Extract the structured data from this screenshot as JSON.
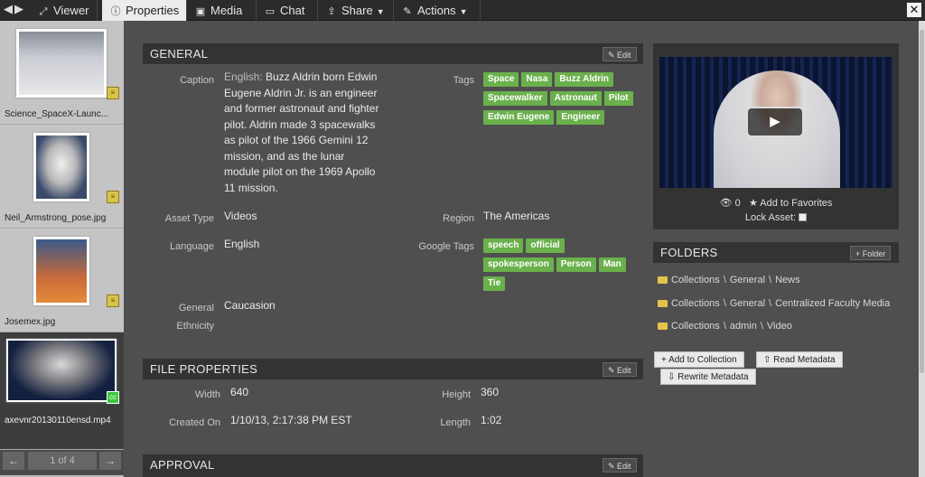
{
  "topbar": {
    "tabs": [
      {
        "label": "Viewer",
        "icon": "expand-icon"
      },
      {
        "label": "Properties",
        "icon": "info-icon"
      },
      {
        "label": "Media",
        "icon": "image-icon"
      },
      {
        "label": "Chat",
        "icon": "comment-icon"
      },
      {
        "label": "Share",
        "icon": "share-icon"
      },
      {
        "label": "Actions",
        "icon": "edit-icon"
      }
    ],
    "close_label": "✕"
  },
  "sidebar": {
    "items": [
      {
        "name": "Science_SpaceX-Launc..."
      },
      {
        "name": "Neil_Armstrong_pose.jpg"
      },
      {
        "name": "Josemex.jpg"
      },
      {
        "name": "axevnr20130110ensd.mp4"
      }
    ],
    "pager": {
      "text": "1 of 4"
    }
  },
  "general": {
    "title": "GENERAL",
    "edit_label": "Edit",
    "caption_label": "Caption",
    "caption_lang": "English:",
    "caption_text": "Buzz Aldrin born Edwin Eugene Aldrin Jr. is an engineer and former astronaut and fighter pilot. Aldrin made 3 spacewalks as pilot of the 1966 Gemini 12 mission, and as the lunar module pilot on the 1969 Apollo 11 mission.",
    "tags_label": "Tags",
    "tags": [
      "Space",
      "Nasa",
      "Buzz Aldrin",
      "Spacewalker",
      "Astronaut",
      "Pilot",
      "Edwin Eugene",
      "Engineer"
    ],
    "asset_type_label": "Asset Type",
    "asset_type": "Videos",
    "region_label": "Region",
    "region": "The Americas",
    "language_label": "Language",
    "language": "English",
    "google_tags_label": "Google Tags",
    "google_tags": [
      "speech",
      "official",
      "spokesperson",
      "Person",
      "Man",
      "Tie"
    ],
    "ethnicity_label_1": "General",
    "ethnicity_label_2": "Ethnicity",
    "ethnicity": "Caucasion"
  },
  "file_properties": {
    "title": "FILE PROPERTIES",
    "edit_label": "Edit",
    "width_label": "Width",
    "width": "640",
    "height_label": "Height",
    "height": "360",
    "created_label": "Created On",
    "created": "1/10/13, 2:17:38 PM EST",
    "length_label": "Length",
    "length": "1:02"
  },
  "approval": {
    "title": "APPROVAL",
    "edit_label": "Edit"
  },
  "video": {
    "views": "0",
    "favorites_label": "Add to Favorites",
    "lock_label": "Lock Asset:"
  },
  "folders": {
    "title": "FOLDERS",
    "add_label": "Folder",
    "paths": [
      [
        "Collections",
        "General",
        "News"
      ],
      [
        "Collections",
        "General",
        "Centralized Faculty Media"
      ],
      [
        "Collections",
        "admin",
        "Video"
      ]
    ],
    "add_collection_label": "Add to Collection",
    "read_metadata_label": "Read Metadata",
    "rewrite_metadata_label": "Rewrite Metadata"
  },
  "colors": {
    "tag": "#6ab04c",
    "header": "#333333",
    "panel": "#575757"
  }
}
